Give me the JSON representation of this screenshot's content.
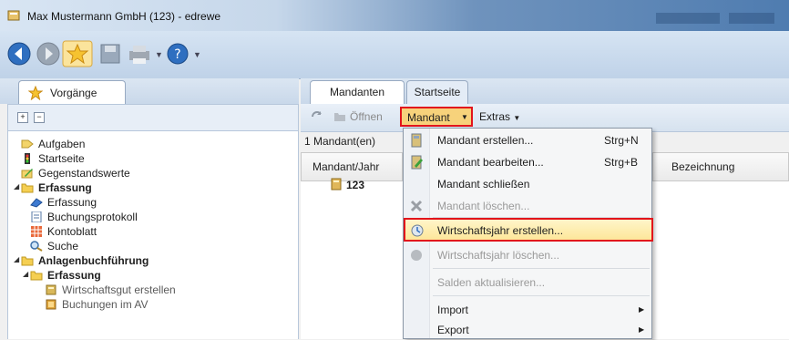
{
  "window": {
    "title": "Max Mustermann GmbH (123) - edrewe"
  },
  "toolbar": {
    "icons": [
      "back-arrow-icon",
      "forward-arrow-icon",
      "favorites-star-icon",
      "save-disk-icon",
      "printer-icon",
      "help-icon"
    ]
  },
  "left_pane": {
    "tab_label": "Vorgänge",
    "tree": [
      {
        "label": "Aufgaben",
        "icon": "task-icon",
        "level": 1
      },
      {
        "label": "Startseite",
        "icon": "traffic-light-icon",
        "level": 1
      },
      {
        "label": "Gegenstandswerte",
        "icon": "pencil-icon",
        "level": 1
      },
      {
        "label": "Erfassung",
        "icon": "folder-icon",
        "level": 0,
        "bold": true,
        "expanded": true
      },
      {
        "label": "Erfassung",
        "icon": "entry-icon",
        "level": 1
      },
      {
        "label": "Buchungsprotokoll",
        "icon": "protocol-icon",
        "level": 1
      },
      {
        "label": "Kontoblatt",
        "icon": "grid-sheet-icon",
        "level": 1
      },
      {
        "label": "Suche",
        "icon": "magnifier-icon",
        "level": 1
      },
      {
        "label": "Anlagenbuchführung",
        "icon": "folder-icon",
        "level": 0,
        "bold": true,
        "expanded": true
      },
      {
        "label": "Erfassung",
        "icon": "folder-icon",
        "level": 1,
        "bold": true,
        "expanded": true
      },
      {
        "label": "Wirtschaftsgut erstellen",
        "icon": "asset-icon",
        "level": 2
      },
      {
        "label": "Buchungen im AV",
        "icon": "asset-bookings-icon",
        "level": 2
      }
    ]
  },
  "right_pane": {
    "tabs": [
      {
        "label": "Mandanten",
        "active": true
      },
      {
        "label": "Startseite",
        "active": false
      }
    ],
    "toolbar": {
      "open_label": "Öffnen",
      "mandant_label": "Mandant",
      "extras_label": "Extras"
    },
    "count_text": "1 Mandant(en)",
    "columns": [
      "Mandant/Jahr",
      "Bezeichnung"
    ],
    "rows": [
      {
        "mandant": "123"
      }
    ]
  },
  "menu": {
    "items": [
      {
        "label": "Mandant erstellen...",
        "shortcut": "Strg+N",
        "disabled": false,
        "icon": "create-client-icon"
      },
      {
        "label": "Mandant bearbeiten...",
        "shortcut": "Strg+B",
        "disabled": false,
        "icon": "edit-client-icon"
      },
      {
        "label": "Mandant schließen",
        "shortcut": "",
        "disabled": false,
        "icon": ""
      },
      {
        "label": "Mandant löschen...",
        "shortcut": "",
        "disabled": true,
        "icon": "delete-x-icon"
      },
      {
        "label": "Wirtschaftsjahr erstellen...",
        "shortcut": "",
        "disabled": false,
        "icon": "create-year-icon",
        "highlighted": true
      },
      {
        "label": "Wirtschaftsjahr löschen...",
        "shortcut": "",
        "disabled": true,
        "icon": "delete-year-icon"
      },
      {
        "label": "Salden aktualisieren...",
        "shortcut": "",
        "disabled": true,
        "icon": ""
      },
      {
        "label": "Import",
        "shortcut": "",
        "disabled": false,
        "submenu": true
      },
      {
        "label": "Export",
        "shortcut": "",
        "disabled": false,
        "submenu": true
      }
    ]
  },
  "colors": {
    "highlight_border": "#e2141b",
    "menu_hover": "#fde79a",
    "title_blue": "#4f7cb0"
  }
}
